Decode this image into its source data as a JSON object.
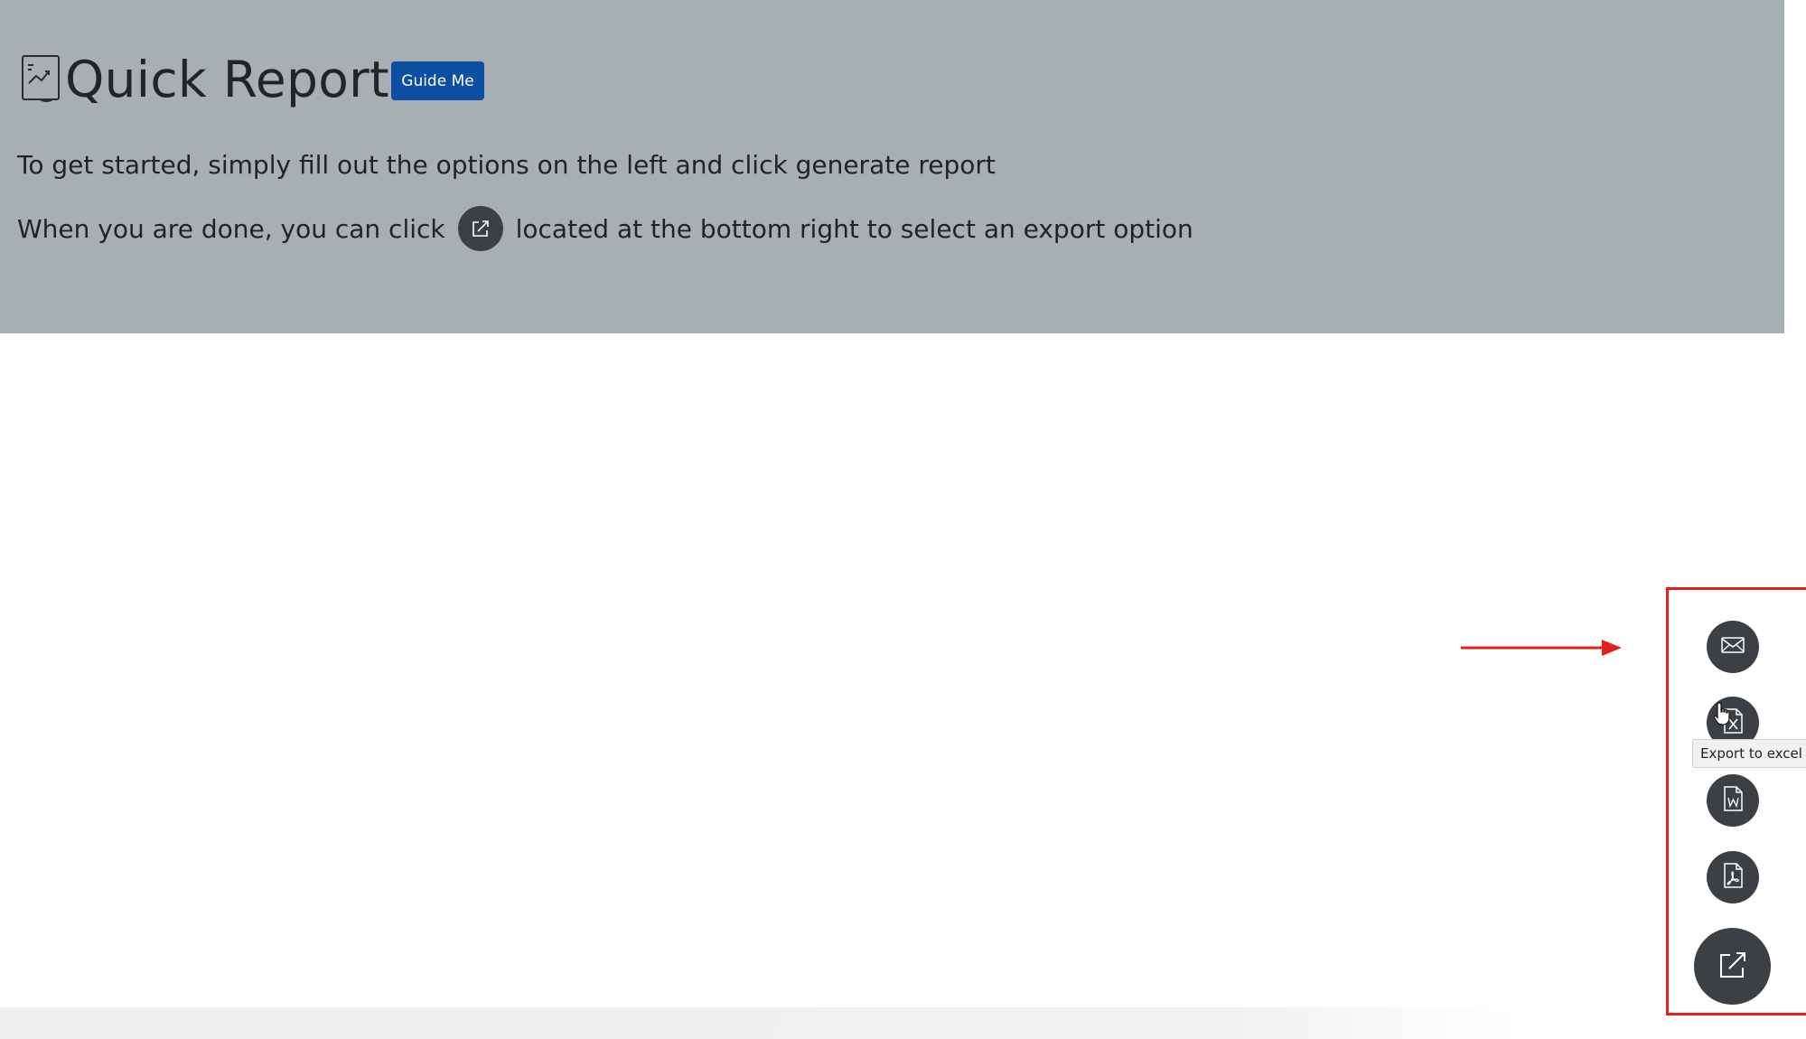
{
  "header": {
    "title": "Quick Report",
    "guide_button_label": "Guide Me",
    "intro_line1": "To get started, simply fill out the options on the left and click generate report",
    "intro_line2_before": "When you are done, you can click",
    "intro_line2_after": "located at the bottom right to select an export option"
  },
  "export_menu": {
    "items": [
      {
        "icon": "email-icon"
      },
      {
        "icon": "excel-icon",
        "tooltip": "Export to excel"
      },
      {
        "icon": "word-icon"
      },
      {
        "icon": "pdf-icon"
      }
    ],
    "main_icon": "external-link-icon"
  },
  "colors": {
    "header_bg": "#a8afb3",
    "guide_button": "#0c4ea2",
    "fab_bg": "#3c3f43",
    "annotation_red": "#e3231b"
  }
}
